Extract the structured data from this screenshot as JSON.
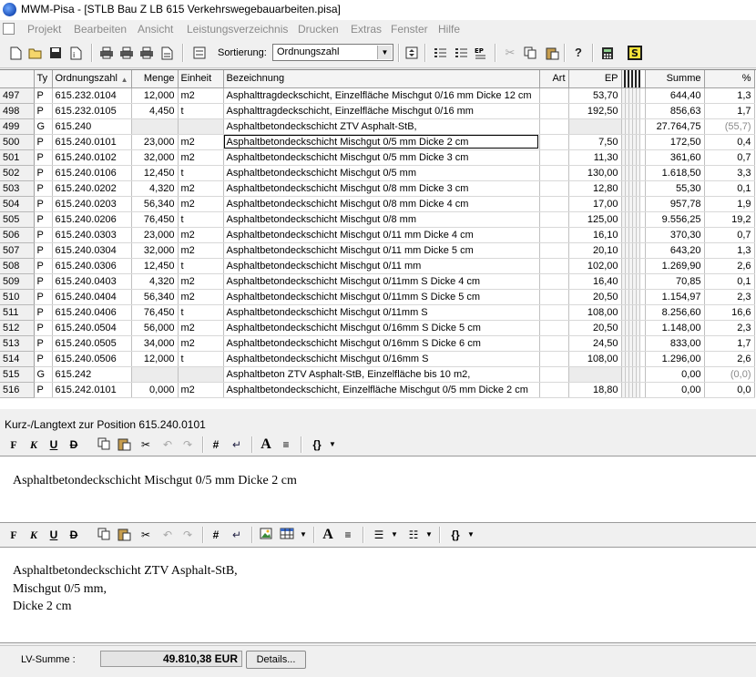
{
  "window": {
    "title": "MWM-Pisa - [STLB Bau Z LB 615 Verkehrswegebauarbeiten.pisa]"
  },
  "menu": [
    "Projekt",
    "Bearbeiten",
    "Ansicht",
    "Leistungsverzeichnis",
    "Drucken",
    "Extras",
    "Fenster",
    "Hilfe"
  ],
  "toolbar": {
    "sort_label": "Sortierung:",
    "sort_value": "Ordnungszahl"
  },
  "grid": {
    "headers": {
      "typ": "Ty",
      "oz": "Ordnungszahl",
      "menge": "Menge",
      "einheit": "Einheit",
      "bez": "Bezeichnung",
      "art": "Art",
      "ep": "EP",
      "summe": "Summe",
      "pct": "%"
    },
    "rows": [
      {
        "nr": "497",
        "typ": "P",
        "oz": "615.232.0104",
        "menge": "12,000",
        "einheit": "m2",
        "bez": "Asphalttragdeckschicht, Einzelfläche Mischgut 0/16 mm Dicke 12 cm",
        "ep": "53,70",
        "summe": "644,40",
        "pct": "1,3"
      },
      {
        "nr": "498",
        "typ": "P",
        "oz": "615.232.0105",
        "menge": "4,450",
        "einheit": "t",
        "bez": "Asphalttragdeckschicht, Einzelfläche Mischgut 0/16 mm",
        "ep": "192,50",
        "summe": "856,63",
        "pct": "1,7"
      },
      {
        "nr": "499",
        "typ": "G",
        "oz": "615.240",
        "menge": "",
        "einheit": "",
        "bez": "Asphaltbetondeckschicht ZTV Asphalt-StB,",
        "ep": "",
        "summe": "27.764,75",
        "pct": "(55,7)"
      },
      {
        "nr": "500",
        "typ": "P",
        "oz": "615.240.0101",
        "menge": "23,000",
        "einheit": "m2",
        "bez": "Asphaltbetondeckschicht Mischgut 0/5 mm Dicke 2 cm",
        "ep": "7,50",
        "summe": "172,50",
        "pct": "0,4"
      },
      {
        "nr": "501",
        "typ": "P",
        "oz": "615.240.0102",
        "menge": "32,000",
        "einheit": "m2",
        "bez": "Asphaltbetondeckschicht Mischgut 0/5 mm Dicke 3 cm",
        "ep": "11,30",
        "summe": "361,60",
        "pct": "0,7"
      },
      {
        "nr": "502",
        "typ": "P",
        "oz": "615.240.0106",
        "menge": "12,450",
        "einheit": "t",
        "bez": "Asphaltbetondeckschicht Mischgut 0/5 mm",
        "ep": "130,00",
        "summe": "1.618,50",
        "pct": "3,3"
      },
      {
        "nr": "503",
        "typ": "P",
        "oz": "615.240.0202",
        "menge": "4,320",
        "einheit": "m2",
        "bez": "Asphaltbetondeckschicht Mischgut 0/8 mm Dicke 3 cm",
        "ep": "12,80",
        "summe": "55,30",
        "pct": "0,1"
      },
      {
        "nr": "504",
        "typ": "P",
        "oz": "615.240.0203",
        "menge": "56,340",
        "einheit": "m2",
        "bez": "Asphaltbetondeckschicht Mischgut 0/8 mm Dicke 4 cm",
        "ep": "17,00",
        "summe": "957,78",
        "pct": "1,9"
      },
      {
        "nr": "505",
        "typ": "P",
        "oz": "615.240.0206",
        "menge": "76,450",
        "einheit": "t",
        "bez": "Asphaltbetondeckschicht Mischgut 0/8 mm",
        "ep": "125,00",
        "summe": "9.556,25",
        "pct": "19,2"
      },
      {
        "nr": "506",
        "typ": "P",
        "oz": "615.240.0303",
        "menge": "23,000",
        "einheit": "m2",
        "bez": "Asphaltbetondeckschicht Mischgut 0/11 mm Dicke 4 cm",
        "ep": "16,10",
        "summe": "370,30",
        "pct": "0,7"
      },
      {
        "nr": "507",
        "typ": "P",
        "oz": "615.240.0304",
        "menge": "32,000",
        "einheit": "m2",
        "bez": "Asphaltbetondeckschicht Mischgut 0/11 mm Dicke 5 cm",
        "ep": "20,10",
        "summe": "643,20",
        "pct": "1,3"
      },
      {
        "nr": "508",
        "typ": "P",
        "oz": "615.240.0306",
        "menge": "12,450",
        "einheit": "t",
        "bez": "Asphaltbetondeckschicht Mischgut 0/11 mm",
        "ep": "102,00",
        "summe": "1.269,90",
        "pct": "2,6"
      },
      {
        "nr": "509",
        "typ": "P",
        "oz": "615.240.0403",
        "menge": "4,320",
        "einheit": "m2",
        "bez": "Asphaltbetondeckschicht Mischgut 0/11mm S Dicke 4 cm",
        "ep": "16,40",
        "summe": "70,85",
        "pct": "0,1"
      },
      {
        "nr": "510",
        "typ": "P",
        "oz": "615.240.0404",
        "menge": "56,340",
        "einheit": "m2",
        "bez": "Asphaltbetondeckschicht Mischgut 0/11mm S Dicke 5 cm",
        "ep": "20,50",
        "summe": "1.154,97",
        "pct": "2,3"
      },
      {
        "nr": "511",
        "typ": "P",
        "oz": "615.240.0406",
        "menge": "76,450",
        "einheit": "t",
        "bez": "Asphaltbetondeckschicht Mischgut 0/11mm S",
        "ep": "108,00",
        "summe": "8.256,60",
        "pct": "16,6"
      },
      {
        "nr": "512",
        "typ": "P",
        "oz": "615.240.0504",
        "menge": "56,000",
        "einheit": "m2",
        "bez": "Asphaltbetondeckschicht Mischgut 0/16mm S Dicke 5 cm",
        "ep": "20,50",
        "summe": "1.148,00",
        "pct": "2,3"
      },
      {
        "nr": "513",
        "typ": "P",
        "oz": "615.240.0505",
        "menge": "34,000",
        "einheit": "m2",
        "bez": "Asphaltbetondeckschicht Mischgut 0/16mm S Dicke 6 cm",
        "ep": "24,50",
        "summe": "833,00",
        "pct": "1,7"
      },
      {
        "nr": "514",
        "typ": "P",
        "oz": "615.240.0506",
        "menge": "12,000",
        "einheit": "t",
        "bez": "Asphaltbetondeckschicht Mischgut 0/16mm S",
        "ep": "108,00",
        "summe": "1.296,00",
        "pct": "2,6"
      },
      {
        "nr": "515",
        "typ": "G",
        "oz": "615.242",
        "menge": "",
        "einheit": "",
        "bez": "Asphaltbeton ZTV Asphalt-StB, Einzelfläche bis 10 m2,",
        "ep": "",
        "summe": "0,00",
        "pct": "(0,0)"
      },
      {
        "nr": "516",
        "typ": "P",
        "oz": "615.242.0101",
        "menge": "0,000",
        "einheit": "m2",
        "bez": "Asphaltbetondeckschicht, Einzelfläche Mischgut 0/5 mm Dicke 2 cm",
        "ep": "18,80",
        "summe": "0,00",
        "pct": "0,0"
      }
    ]
  },
  "kurztext": {
    "label": "Kurz-/Langtext zur Position 615.240.0101",
    "short_text": "Asphaltbetondeckschicht Mischgut 0/5 mm Dicke 2 cm",
    "long_text": [
      "Asphaltbetondeckschicht ZTV Asphalt-StB,",
      "Mischgut 0/5 mm,",
      "Dicke 2 cm"
    ]
  },
  "status": {
    "label": "LV-Summe :",
    "value": "49.810,38 EUR",
    "details_button": "Details..."
  }
}
